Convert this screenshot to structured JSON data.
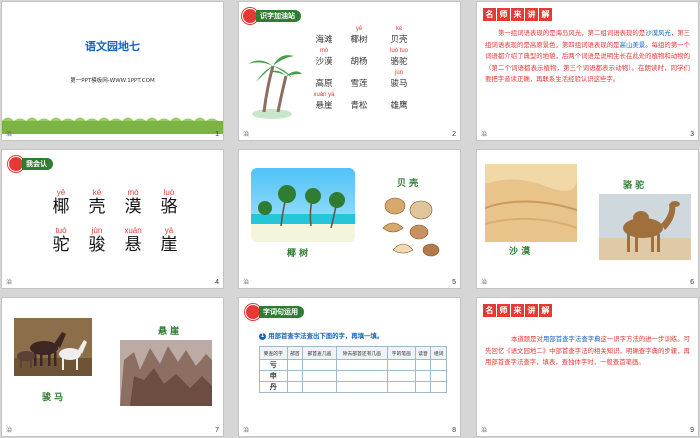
{
  "slide1": {
    "title": "语文园地七",
    "subtitle": "第一PPT模板网-WWW.1PPT.COM",
    "num": "1",
    "bl": "治"
  },
  "slide2": {
    "badge": "识字加油站",
    "num": "2",
    "bl": "治",
    "words": [
      {
        "py": "",
        "ch": "海滩"
      },
      {
        "py": "yē",
        "ch": "椰树"
      },
      {
        "py": "ké",
        "ch": "贝壳"
      },
      {
        "py": "mò",
        "ch": "沙漠"
      },
      {
        "py": "",
        "ch": "胡杨"
      },
      {
        "py": "luò tuo",
        "ch": "骆驼"
      },
      {
        "py": "",
        "ch": "高原"
      },
      {
        "py": "",
        "ch": "雪莲"
      },
      {
        "py": "jùn",
        "ch": "骏马"
      },
      {
        "py": "xuán yá",
        "ch": "悬崖"
      },
      {
        "py": "",
        "ch": "青松"
      },
      {
        "py": "",
        "ch": "雄鹰"
      }
    ]
  },
  "slide3": {
    "teach": [
      "名",
      "师",
      "来",
      "讲",
      "解"
    ],
    "num": "3",
    "bl": "治",
    "para": [
      {
        "t": "第一组词语表现的是海岛风光，第二组词语表现的是",
        "c": "r"
      },
      {
        "t": "沙漠风光",
        "c": "b"
      },
      {
        "t": "，第三组词语表现的是高原景色，第四组词语表现的是",
        "c": "r"
      },
      {
        "t": "高山美景",
        "c": "b"
      },
      {
        "t": "。每组的第一个词语都介绍了典型的地貌，后两个词语是说明生长在此处的植物和动物的（第二个词语都表示植物，第三个词语都表示动物）。在朗读时，同学们要把字音读正确，再联系生活经验认识这些字。",
        "c": "r"
      }
    ]
  },
  "slide4": {
    "badge": "我会认",
    "num": "4",
    "bl": "治",
    "row1": [
      {
        "py": "yē",
        "ch": "椰"
      },
      {
        "py": "ké",
        "ch": "壳"
      },
      {
        "py": "mò",
        "ch": "漠"
      },
      {
        "py": "luò",
        "ch": "骆"
      }
    ],
    "row2": [
      {
        "py": "tuó",
        "ch": "驼"
      },
      {
        "py": "jùn",
        "ch": "骏"
      },
      {
        "py": "xuán",
        "ch": "悬"
      },
      {
        "py": "yá",
        "ch": "崖"
      }
    ]
  },
  "slide5": {
    "cap1": "椰 树",
    "cap2": "贝 壳",
    "num": "5",
    "bl": "治"
  },
  "slide6": {
    "cap1": "沙 漠",
    "cap2": "骆 驼",
    "num": "6",
    "bl": "治"
  },
  "slide7": {
    "cap1": "骏 马",
    "cap2": "悬 崖",
    "num": "7",
    "bl": "治"
  },
  "slide8": {
    "badge": "字词句运用",
    "num": "8",
    "bl": "治",
    "instruction": "用部首查字法查出下面的字，再填一填。",
    "headers": [
      "要查的字",
      "部首",
      "部首查几画",
      "除去部首还有几画",
      "字的笔画",
      "读音",
      "组词"
    ],
    "rows": [
      "亏",
      "申",
      "丹"
    ]
  },
  "slide9": {
    "teach": [
      "名",
      "师",
      "来",
      "讲",
      "解"
    ],
    "num": "9",
    "bl": "治",
    "para": [
      {
        "t": "本道题是对",
        "c": "r"
      },
      {
        "t": "用部首查字法查字典",
        "c": "b"
      },
      {
        "t": "这一识字方法的进一步训练。可先回忆《语文园地二》中部首查字法的相关知识，明确查字典的步骤，再用部首查字法查字，填表，查独体字时，一般查首笔画。",
        "c": "r"
      }
    ]
  },
  "colors": {
    "green": "#2e7d32",
    "red": "#e53935",
    "blue": "#1565c0",
    "gray": "#d6d6d6"
  }
}
